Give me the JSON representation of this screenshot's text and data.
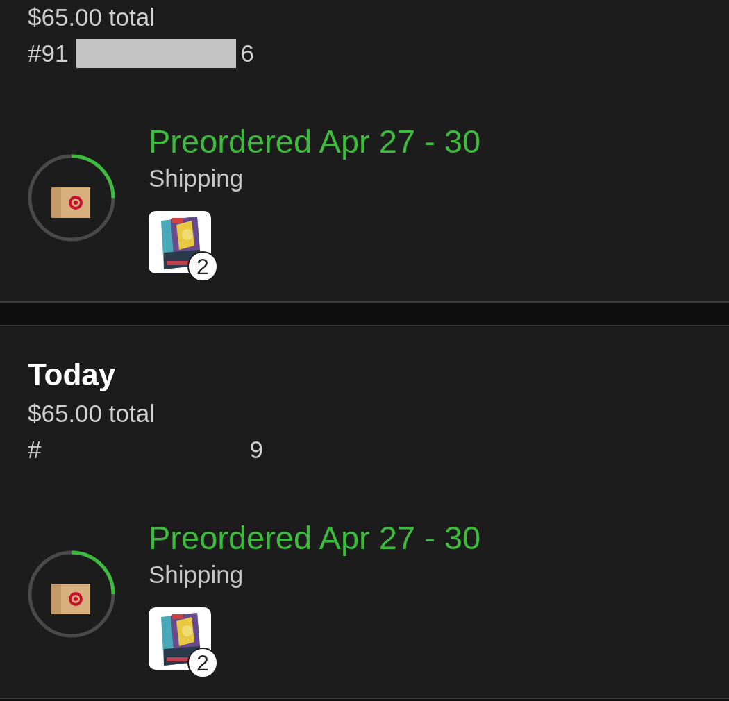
{
  "orders": [
    {
      "total": "$65.00 total",
      "order_number": {
        "start": "#91",
        "end": "6",
        "kind": "block"
      },
      "status": "Preordered Apr 27 - 30",
      "substatus": "Shipping",
      "progress": {
        "level": 0.25
      },
      "items": [
        {
          "quantity": "2"
        }
      ]
    },
    {
      "heading": "Today",
      "total": "$65.00 total",
      "order_number": {
        "start": "#",
        "end": "9",
        "kind": "erased"
      },
      "status": "Preordered Apr 27 - 30",
      "substatus": "Shipping",
      "progress": {
        "level": 0.25
      },
      "items": [
        {
          "quantity": "2"
        }
      ]
    }
  ]
}
